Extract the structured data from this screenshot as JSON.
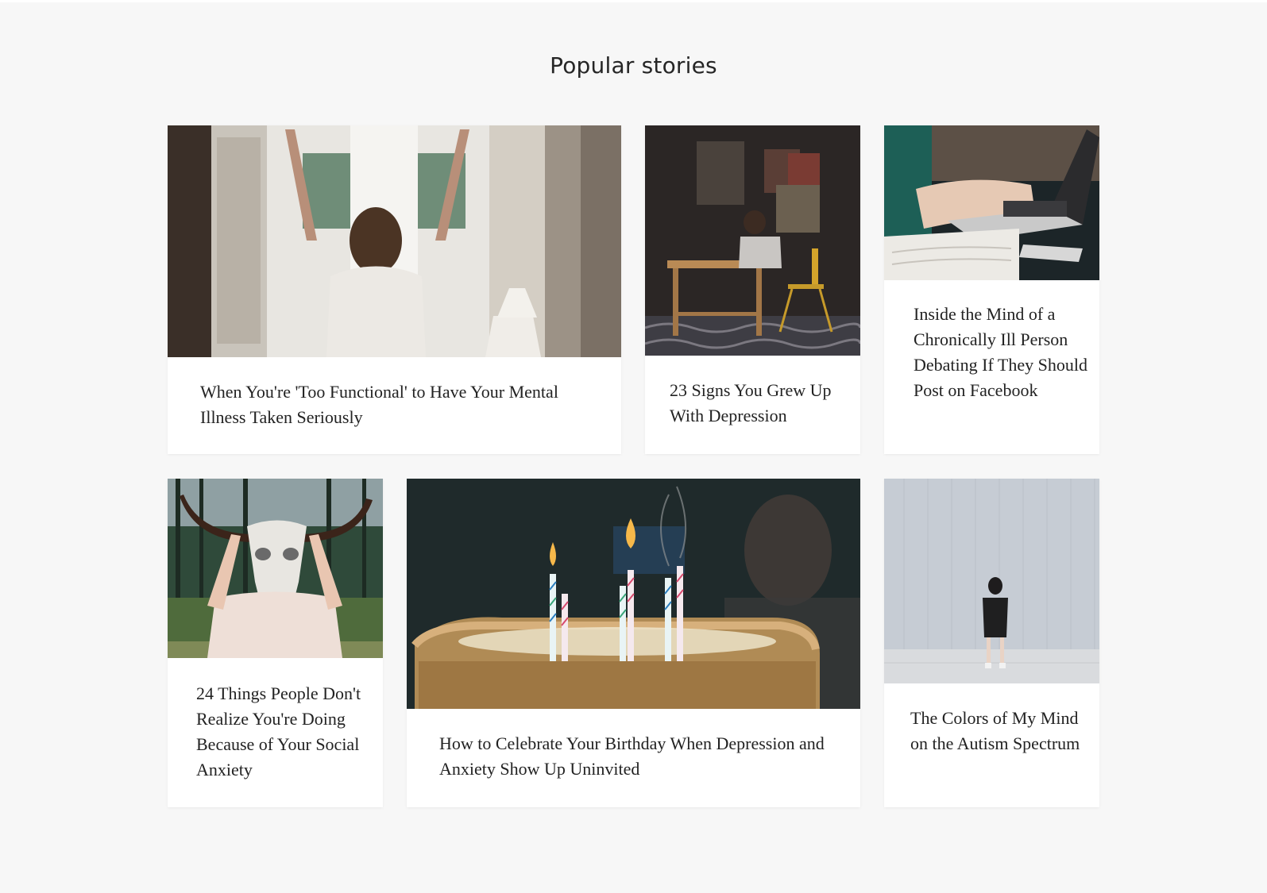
{
  "section": {
    "title": "Popular stories"
  },
  "stories": [
    {
      "title": "When You're 'Too Functional' to Have Your Mental Illness Taken Seriously",
      "image_icon": "woman-at-window-image"
    },
    {
      "title": "23 Signs You Grew Up With Depression",
      "image_icon": "child-at-desk-image"
    },
    {
      "title": "Inside the Mind of a Chronically Ill Person Debating If They Should Post on Facebook",
      "image_icon": "laptop-typing-image"
    },
    {
      "title": "24 Things People Don't Realize You're Doing Because of Your Social Anxiety",
      "image_icon": "skull-mask-image"
    },
    {
      "title": "How to Celebrate Your Birthday When Depression and Anxiety Show Up Uninvited",
      "image_icon": "birthday-cake-image"
    },
    {
      "title": "The Colors of My Mind on the Autism Spectrum",
      "image_icon": "girl-by-wall-image"
    }
  ]
}
